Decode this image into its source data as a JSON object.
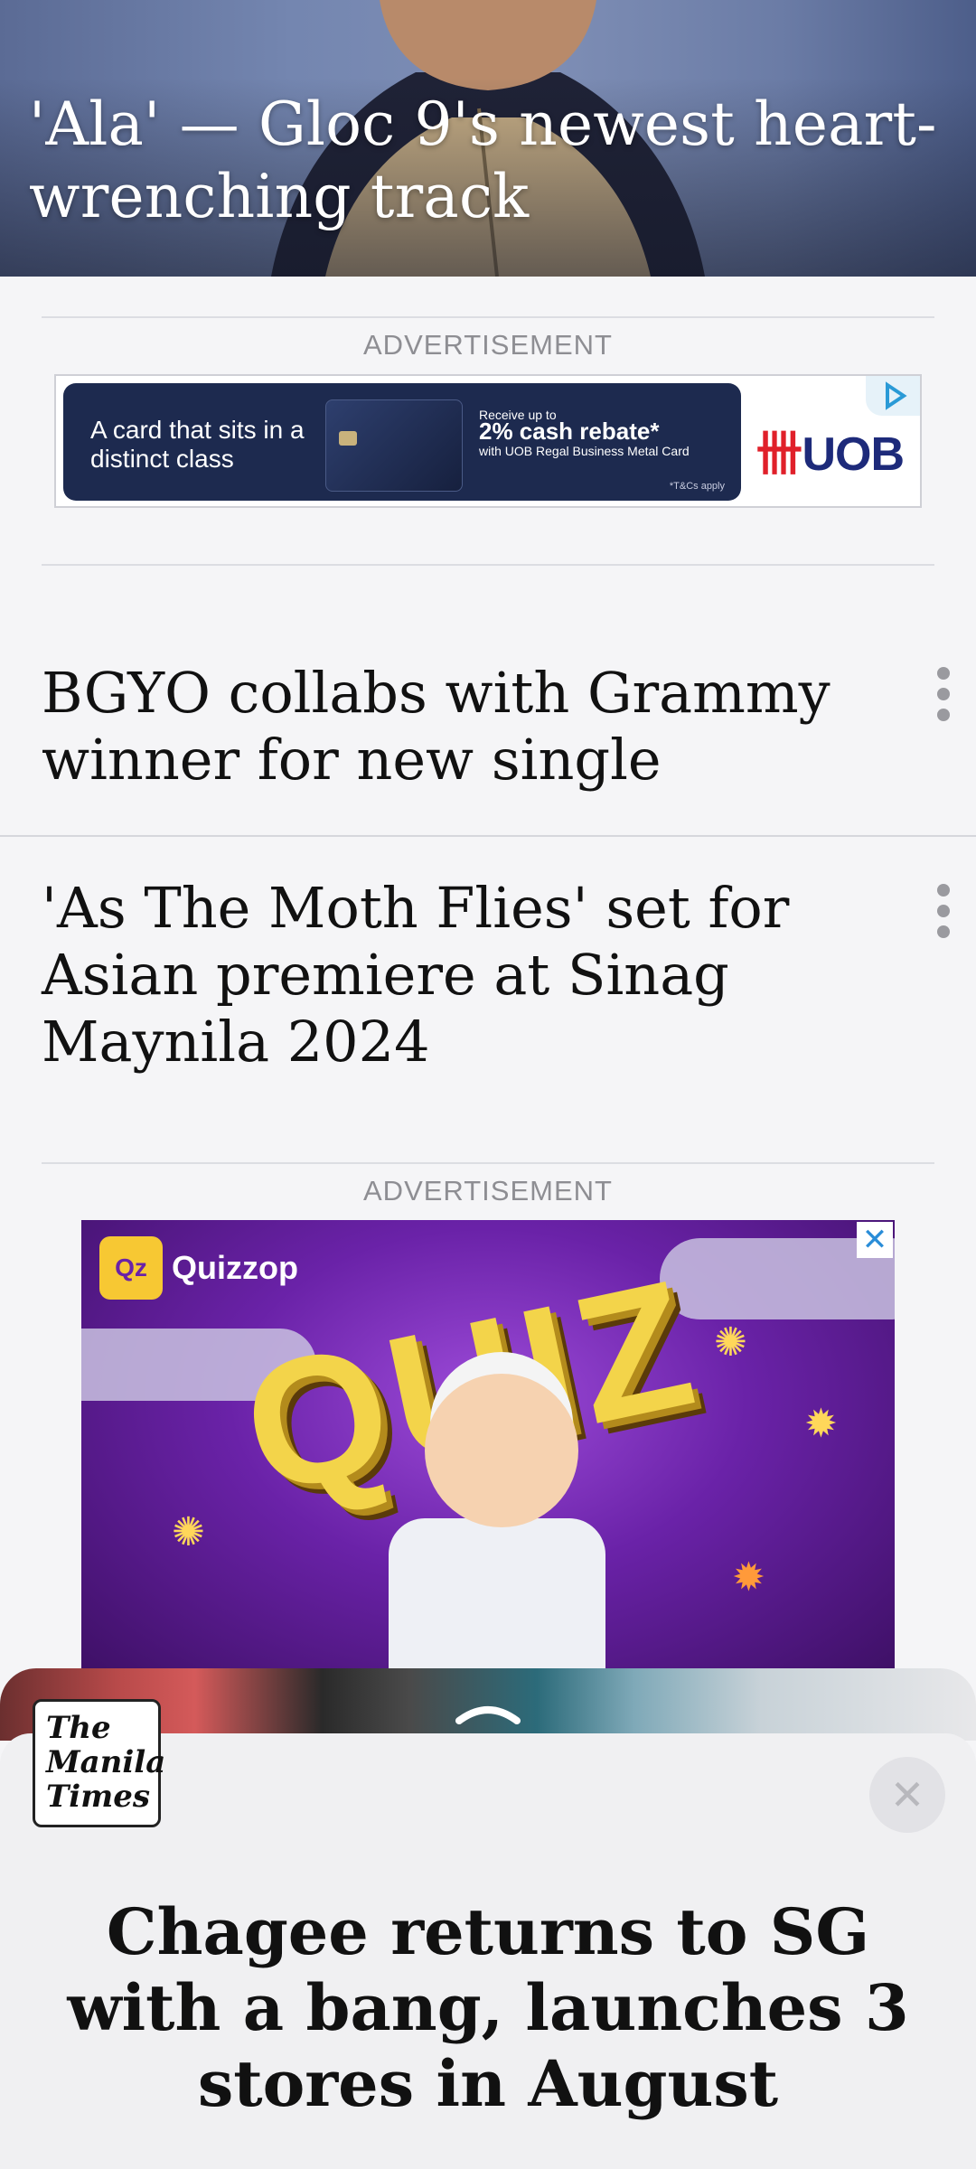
{
  "hero": {
    "title": "'Ala' — Gloc 9's newest heart-wrenching track"
  },
  "ads": {
    "label_top": "ADVERTISEMENT",
    "label_bottom": "ADVERTISEMENT",
    "uob": {
      "tagline": "A card that sits in a distinct class",
      "offer_line1": "Receive up to",
      "offer_line2": "2% cash rebate*",
      "offer_line3": "with UOB Regal Business Metal Card",
      "tc": "*T&Cs apply",
      "logo": "UOB",
      "logo_mark": "卌"
    },
    "quiz": {
      "brand": "Quizzop",
      "logo_text": "Qz",
      "headline": "QUIZ",
      "close_glyph": "✕"
    }
  },
  "articles": [
    {
      "title": "BGYO collabs with Grammy winner for new single"
    },
    {
      "title": "'As The Moth Flies' set for Asian premiere at Sinag Maynila 2024"
    }
  ],
  "bottom_sheet": {
    "publisher": "The Manila Times",
    "headline": "Chagee returns to SG with a bang, launches 3 stores in August",
    "close_glyph": "✕"
  }
}
